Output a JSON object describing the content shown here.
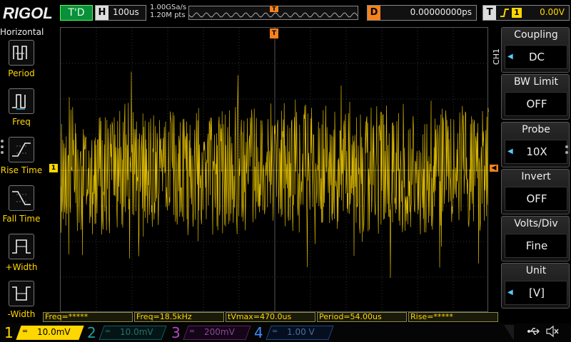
{
  "brand": "RIGOL",
  "top": {
    "run_state": "T'D",
    "horizontal_key": "H",
    "timebase": "100us",
    "sample_rate": "1.00GSa/s",
    "memory_depth": "1.20M pts",
    "delay_key": "D",
    "delay": "0.00000000ps",
    "trigger_key": "T",
    "trigger_source": "1",
    "trigger_level": "0.00V"
  },
  "left_menu": {
    "title": "Horizontal",
    "items": [
      {
        "label": "Period",
        "icon": "period-icon"
      },
      {
        "label": "Freq",
        "icon": "freq-icon"
      },
      {
        "label": "Rise Time",
        "icon": "rise-time-icon"
      },
      {
        "label": "Fall Time",
        "icon": "fall-time-icon"
      },
      {
        "label": "+Width",
        "icon": "pos-width-icon"
      },
      {
        "label": "-Width",
        "icon": "neg-width-icon"
      }
    ]
  },
  "markers": {
    "ch1": "1",
    "trigger_position": "T"
  },
  "right_menu": {
    "channel_tag": "CH1",
    "items": [
      {
        "label": "Coupling",
        "value": "DC",
        "has_arrow": true
      },
      {
        "label": "BW Limit",
        "value": "OFF",
        "has_arrow": false
      },
      {
        "label": "Probe",
        "value": "10X",
        "has_arrow": true
      },
      {
        "label": "Invert",
        "value": "OFF",
        "has_arrow": false
      },
      {
        "label": "Volts/Div",
        "value": "Fine",
        "has_arrow": false
      },
      {
        "label": "Unit",
        "value": "[V]",
        "has_arrow": true
      }
    ]
  },
  "measurements": [
    "Freq=*****",
    "Freq=18.5kHz",
    "tVmax=470.0us",
    "Period=54.00us",
    "Rise=*****"
  ],
  "channels": [
    {
      "num": "1",
      "scale": "10.0mV",
      "active": true
    },
    {
      "num": "2",
      "scale": "10.0mV",
      "active": false
    },
    {
      "num": "3",
      "scale": "200mV",
      "active": false
    },
    {
      "num": "4",
      "scale": "1.00 V",
      "active": false
    }
  ],
  "colors": {
    "ch1": "#ffd700",
    "ch2": "#1aa3a3",
    "ch3": "#b844c8",
    "ch4": "#3c8cff",
    "trigger": "#f5821f",
    "run_state": "#0a8f3a"
  }
}
